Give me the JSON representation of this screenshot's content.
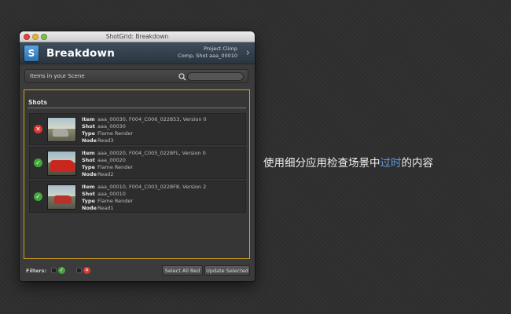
{
  "window": {
    "title": "ShotGrid: Breakdown"
  },
  "header": {
    "logo_letter": "S",
    "app_name": "Breakdown",
    "context_line1": "Project Climp",
    "context_line2": "Comp, Shot aaa_00010",
    "chevron": "›"
  },
  "search": {
    "title": "Items in your Scene",
    "placeholder": "",
    "value": ""
  },
  "section": {
    "title": "Shots"
  },
  "labels": {
    "item": "Item",
    "shot": "Shot",
    "type": "Type",
    "node": "Node"
  },
  "items": [
    {
      "status": "out-of-date",
      "status_glyph": "✕",
      "item": "aaa_00030, F004_C006_022853, Version 0",
      "shot": "aaa_00030",
      "type": "Flame Render",
      "node": "Read3"
    },
    {
      "status": "up-to-date",
      "status_glyph": "✓",
      "item": "aaa_00020, F004_C005_0228FL, Version 0",
      "shot": "aaa_00020",
      "type": "Flame Render",
      "node": "Read2"
    },
    {
      "status": "up-to-date",
      "status_glyph": "✓",
      "item": "aaa_00010, F004_C003_0228F8, Version 2",
      "shot": "aaa_00010",
      "type": "Flame Render",
      "node": "Read1"
    }
  ],
  "footer": {
    "filters_label": "Filters:",
    "filter_ok_glyph": "✓",
    "filter_bad_glyph": "✕",
    "select_all_red": "Select All Red",
    "update_selected": "Update Selected"
  },
  "caption": {
    "before": "使用细分应用检查场景中",
    "highlight": "过时",
    "after": "的内容"
  },
  "colors": {
    "accent_border": "#d69f1f",
    "status_bad": "#d83a32",
    "status_ok": "#43a83a",
    "caption_highlight": "#5a9ee6"
  },
  "icons": [
    "close-button-icon",
    "minimize-button-icon",
    "maximize-button-icon",
    "shotgrid-logo-icon",
    "chevron-right-icon",
    "search-icon",
    "error-status-icon",
    "check-status-icon"
  ]
}
